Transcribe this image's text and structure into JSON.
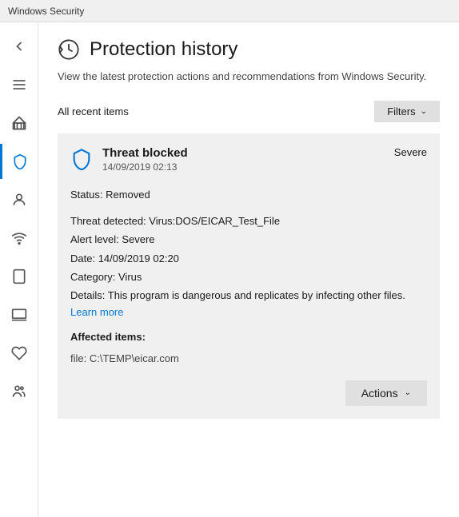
{
  "titlebar": {
    "label": "Windows Security"
  },
  "sidebar": {
    "items": [
      {
        "id": "back",
        "icon": "back-icon",
        "active": false
      },
      {
        "id": "menu",
        "icon": "hamburger-icon",
        "active": false
      },
      {
        "id": "home",
        "icon": "home-icon",
        "active": false
      },
      {
        "id": "shield",
        "icon": "shield-icon",
        "active": true
      },
      {
        "id": "user",
        "icon": "user-icon",
        "active": false
      },
      {
        "id": "wifi",
        "icon": "wifi-icon",
        "active": false
      },
      {
        "id": "tablet",
        "icon": "tablet-icon",
        "active": false
      },
      {
        "id": "laptop",
        "icon": "laptop-icon",
        "active": false
      },
      {
        "id": "health",
        "icon": "health-icon",
        "active": false
      },
      {
        "id": "family",
        "icon": "family-icon",
        "active": false
      }
    ]
  },
  "page": {
    "title": "Protection history",
    "description": "View the latest protection actions and recommendations from Windows Security.",
    "filter_label": "All recent items",
    "filters_button": "Filters"
  },
  "threat": {
    "name": "Threat blocked",
    "date": "14/09/2019 02:13",
    "severity": "Severe",
    "status_label": "Status:",
    "status_value": "Removed",
    "threat_detected_label": "Threat detected:",
    "threat_detected_value": "Virus:DOS/EICAR_Test_File",
    "alert_level_label": "Alert level:",
    "alert_level_value": "Severe",
    "date_label": "Date:",
    "date_value": "14/09/2019 02:20",
    "category_label": "Category:",
    "category_value": "Virus",
    "details_label": "Details:",
    "details_value": "This program is dangerous and replicates by infecting other files.",
    "learn_more": "Learn more",
    "affected_items_label": "Affected items:",
    "affected_item": "file: C:\\TEMP\\eicar.com",
    "actions_button": "Actions"
  }
}
